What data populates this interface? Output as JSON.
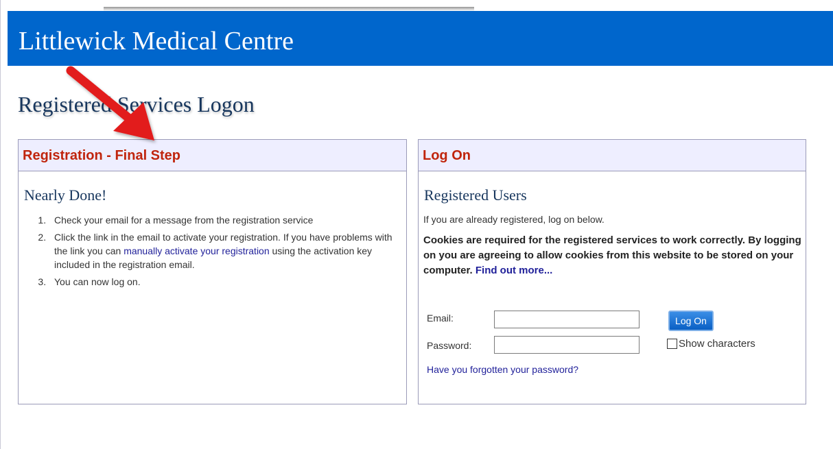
{
  "header": {
    "site_title": "Littlewick Medical Centre"
  },
  "page_title": "Registered Services Logon",
  "registration_panel": {
    "title": "Registration - Final Step",
    "subheading": "Nearly Done!",
    "steps": [
      "Check your email for a message from the registration service",
      "Click the link in the email to activate your registration. If you have problems with the link you can",
      "You can now log on."
    ],
    "step2_link": "manually activate your registration",
    "step2_suffix": "using the activation key included in the registration email."
  },
  "logon_panel": {
    "title": "Log On",
    "subheading": "Registered Users",
    "intro": "If you are already registered, log on below.",
    "cookie_note": "Cookies are required for the registered services to work correctly. By logging on you are agreeing to allow cookies from this website to be stored on your computer.",
    "cookie_link": "Find out more...",
    "email_label": "Email:",
    "email_value": "",
    "password_label": "Password:",
    "password_value": "",
    "logon_button": "Log On",
    "show_characters_label": "Show characters",
    "show_characters_checked": false,
    "forgot_link": "Have you forgotten your password?"
  },
  "colors": {
    "header_bg": "#0066cc",
    "panel_title": "#c0240c",
    "heading_navy": "#17365d",
    "link": "#1f1f99",
    "annotation_arrow": "#e21b1b"
  },
  "icons": {
    "annotation": "red-arrow-icon"
  }
}
